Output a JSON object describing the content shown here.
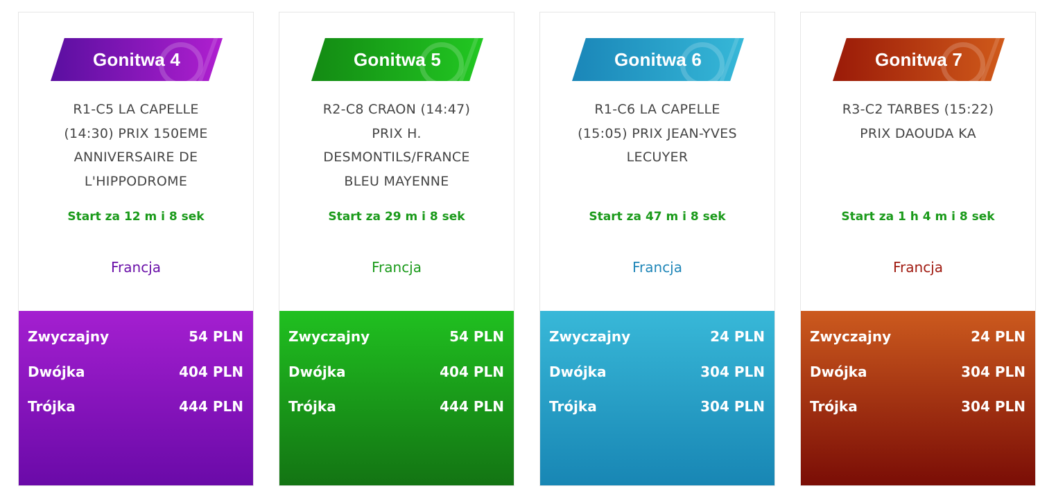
{
  "cards": [
    {
      "badge": "Gonitwa 4",
      "race": "R1-C5 LA CAPELLE (14:30) PRIX 150EME ANNIVERSAIRE DE L'HIPPODROME",
      "race_lines": [
        "R1-C5 LA CAPELLE",
        "(14:30) PRIX 150EME",
        "ANNIVERSAIRE DE",
        "L'HIPPODROME"
      ],
      "start": "Start za 12 m i 8 sek",
      "country": "Francja",
      "pools": [
        {
          "name": "Zwyczajny",
          "value": "54 PLN"
        },
        {
          "name": "Dwójka",
          "value": "404 PLN"
        },
        {
          "name": "Trójka",
          "value": "444 PLN"
        }
      ],
      "colors": {
        "badge_from": "#5a0fa0",
        "badge_to": "#b01fd0",
        "text": "#6a10a8",
        "pool_from": "#a41fd0",
        "pool_to": "#6a0aa8"
      }
    },
    {
      "badge": "Gonitwa 5",
      "race": "R2-C8 CRAON (14:47) PRIX H. DESMONTILS/FRANCE BLEU MAYENNE",
      "race_lines": [
        "R2-C8 CRAON (14:47)",
        "PRIX H.",
        "DESMONTILS/FRANCE",
        "BLEU MAYENNE"
      ],
      "start": "Start za 29 m i 8 sek",
      "country": "Francja",
      "pools": [
        {
          "name": "Zwyczajny",
          "value": "54 PLN"
        },
        {
          "name": "Dwójka",
          "value": "404 PLN"
        },
        {
          "name": "Trójka",
          "value": "444 PLN"
        }
      ],
      "colors": {
        "badge_from": "#138a13",
        "badge_to": "#22c822",
        "text": "#1a9a1a",
        "pool_from": "#20c020",
        "pool_to": "#137413"
      }
    },
    {
      "badge": "Gonitwa 6",
      "race": "R1-C6 LA CAPELLE (15:05) PRIX JEAN-YVES LECUYER",
      "race_lines": [
        "R1-C6 LA CAPELLE",
        "(15:05) PRIX JEAN-YVES",
        "LECUYER"
      ],
      "start": "Start za 47 m i 8 sek",
      "country": "Francja",
      "pools": [
        {
          "name": "Zwyczajny",
          "value": "24 PLN"
        },
        {
          "name": "Dwójka",
          "value": "304 PLN"
        },
        {
          "name": "Trójka",
          "value": "304 PLN"
        }
      ],
      "colors": {
        "badge_from": "#1a86b8",
        "badge_to": "#36b8d8",
        "text": "#1f86b8",
        "pool_from": "#38b8d8",
        "pool_to": "#1886b4"
      }
    },
    {
      "badge": "Gonitwa 7",
      "race": "R3-C2 TARBES (15:22) PRIX DAOUDA KA",
      "race_lines": [
        "R3-C2 TARBES (15:22)",
        "PRIX DAOUDA KA"
      ],
      "start": "Start za 1 h 4 m i 8 sek",
      "country": "Francja",
      "pools": [
        {
          "name": "Zwyczajny",
          "value": "24 PLN"
        },
        {
          "name": "Dwójka",
          "value": "304 PLN"
        },
        {
          "name": "Trójka",
          "value": "304 PLN"
        }
      ],
      "colors": {
        "badge_from": "#9a1a08",
        "badge_to": "#d05a1a",
        "text": "#a01a10",
        "pool_from": "#cc5a1e",
        "pool_to": "#7a0d06"
      }
    }
  ]
}
